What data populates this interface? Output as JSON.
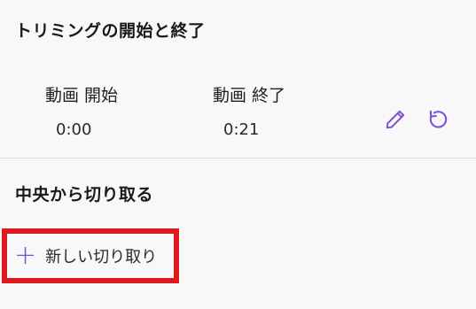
{
  "trim": {
    "title": "トリミングの開始と終了",
    "start_label": "動画 開始",
    "start_value": "0:00",
    "end_label": "動画 終了",
    "end_value": "0:21",
    "edit_icon": "pencil-icon",
    "reset_icon": "rotate-icon"
  },
  "cut": {
    "title": "中央から切り取る",
    "new_cut_label": "新しい切り取り",
    "add_icon": "plus-icon"
  },
  "colors": {
    "accent": "#7b4fd8",
    "highlight_border": "#e0191f",
    "background": "#f8f8f9"
  }
}
